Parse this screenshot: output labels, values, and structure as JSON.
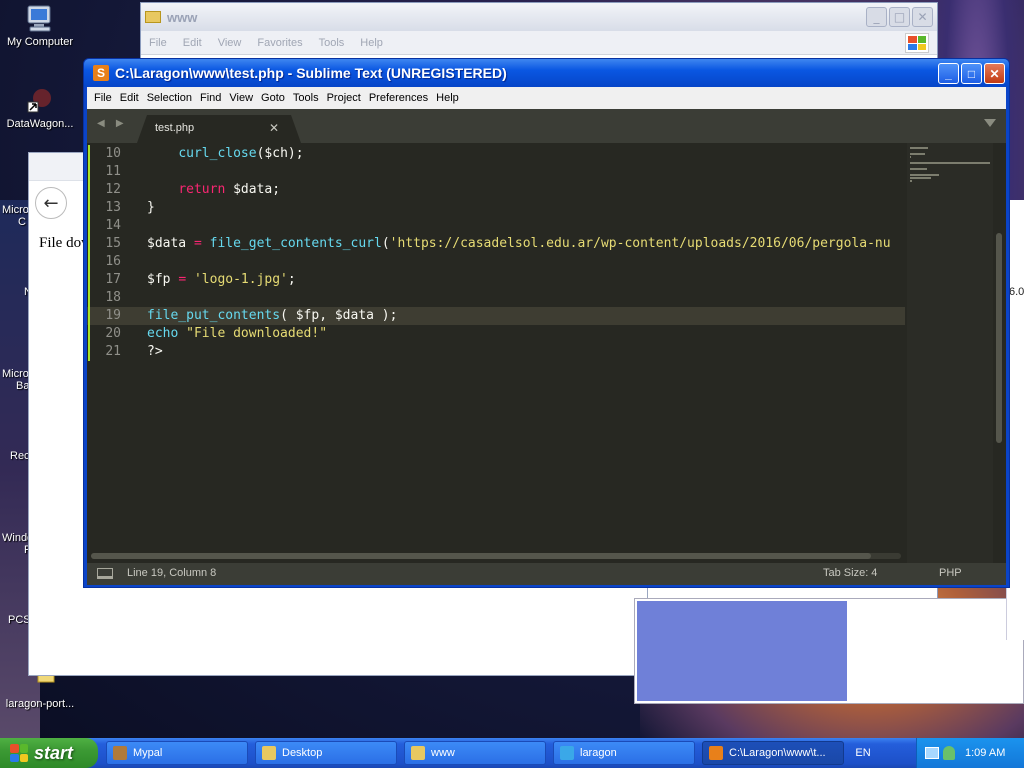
{
  "desktop": {
    "icons": [
      {
        "id": "my-computer",
        "label": "My Computer"
      },
      {
        "id": "datawagon",
        "label": "DataWagon..."
      },
      {
        "id": "laragon-port",
        "label": "laragon-port..."
      }
    ],
    "clipped_labels": [
      "Micro",
      "C",
      "N",
      "Micro",
      "Ba",
      "Rec",
      "Windo",
      "F",
      "PCS"
    ]
  },
  "explorer_window": {
    "title": "www",
    "menu": [
      "File",
      "Edit",
      "View",
      "Favorites",
      "Tools",
      "Help"
    ],
    "caption_buttons": [
      "minimize",
      "maximize",
      "close"
    ]
  },
  "browser_window": {
    "back_glyph": "←",
    "page_text": "File dov"
  },
  "far_right_fragment": "6.0",
  "sublime": {
    "title": "C:\\Laragon\\www\\test.php - Sublime Text (UNREGISTERED)",
    "logo_glyph": "S",
    "caption_buttons": {
      "minimize": "_",
      "maximize": "□",
      "close": "✕"
    },
    "menu": [
      "File",
      "Edit",
      "Selection",
      "Find",
      "View",
      "Goto",
      "Tools",
      "Project",
      "Preferences",
      "Help"
    ],
    "nav_arrows": "◀ ▶",
    "tab": {
      "name": "test.php",
      "close_glyph": "✕"
    },
    "current_line": 19,
    "modified_lines": [
      10,
      11,
      12,
      13,
      14,
      15,
      16,
      17,
      18,
      19,
      20,
      21
    ],
    "lines": [
      {
        "n": "10",
        "tokens": [
          {
            "t": "    ",
            "c": "pl"
          },
          {
            "t": "curl_close",
            "c": "fn"
          },
          {
            "t": "($ch);",
            "c": "pl"
          }
        ]
      },
      {
        "n": "11",
        "tokens": []
      },
      {
        "n": "12",
        "tokens": [
          {
            "t": "    ",
            "c": "pl"
          },
          {
            "t": "return",
            "c": "kw"
          },
          {
            "t": " $data;",
            "c": "pl"
          }
        ]
      },
      {
        "n": "13",
        "tokens": [
          {
            "t": "}",
            "c": "pl"
          }
        ]
      },
      {
        "n": "14",
        "tokens": []
      },
      {
        "n": "15",
        "tokens": [
          {
            "t": "$data ",
            "c": "pl"
          },
          {
            "t": "=",
            "c": "op"
          },
          {
            "t": " ",
            "c": "pl"
          },
          {
            "t": "file_get_contents_curl",
            "c": "fn"
          },
          {
            "t": "(",
            "c": "pl"
          },
          {
            "t": "'https://casadelsol.edu.ar/wp-content/uploads/2016/06/pergola-nu",
            "c": "str"
          }
        ]
      },
      {
        "n": "16",
        "tokens": []
      },
      {
        "n": "17",
        "tokens": [
          {
            "t": "$fp ",
            "c": "pl"
          },
          {
            "t": "=",
            "c": "op"
          },
          {
            "t": " ",
            "c": "pl"
          },
          {
            "t": "'logo-1.jpg'",
            "c": "str"
          },
          {
            "t": ";",
            "c": "pl"
          }
        ]
      },
      {
        "n": "18",
        "tokens": []
      },
      {
        "n": "19",
        "tokens": [
          {
            "t": "file_put_contents",
            "c": "fn"
          },
          {
            "t": "( $fp, $data );",
            "c": "pl"
          }
        ]
      },
      {
        "n": "20",
        "tokens": [
          {
            "t": "echo",
            "c": "fn"
          },
          {
            "t": " ",
            "c": "pl"
          },
          {
            "t": "\"File downloaded!\"",
            "c": "str"
          }
        ]
      },
      {
        "n": "21",
        "tokens": [
          {
            "t": "?>",
            "c": "pl"
          }
        ]
      }
    ],
    "status": {
      "position": "Line 19, Column 8",
      "tab_size": "Tab Size: 4",
      "syntax": "PHP"
    },
    "colors": {
      "background": "#272822",
      "function": "#66d9ef",
      "keyword": "#f92672",
      "string": "#e6db74",
      "plain": "#f8f8f2",
      "gutter_modified": "#a6e22e"
    }
  },
  "taskbar": {
    "start_label": "start",
    "tasks": [
      {
        "label": "Mypal",
        "icon_color": "#b07a3a",
        "active": false
      },
      {
        "label": "Desktop",
        "icon_color": "#e8c860",
        "active": false
      },
      {
        "label": "www",
        "icon_color": "#e8c860",
        "active": false
      },
      {
        "label": "laragon",
        "icon_color": "#3aa8e8",
        "active": false
      },
      {
        "label": "C:\\Laragon\\www\\t...",
        "icon_color": "#e8801a",
        "active": true
      }
    ],
    "language": "EN",
    "clock": "1:09 AM"
  }
}
